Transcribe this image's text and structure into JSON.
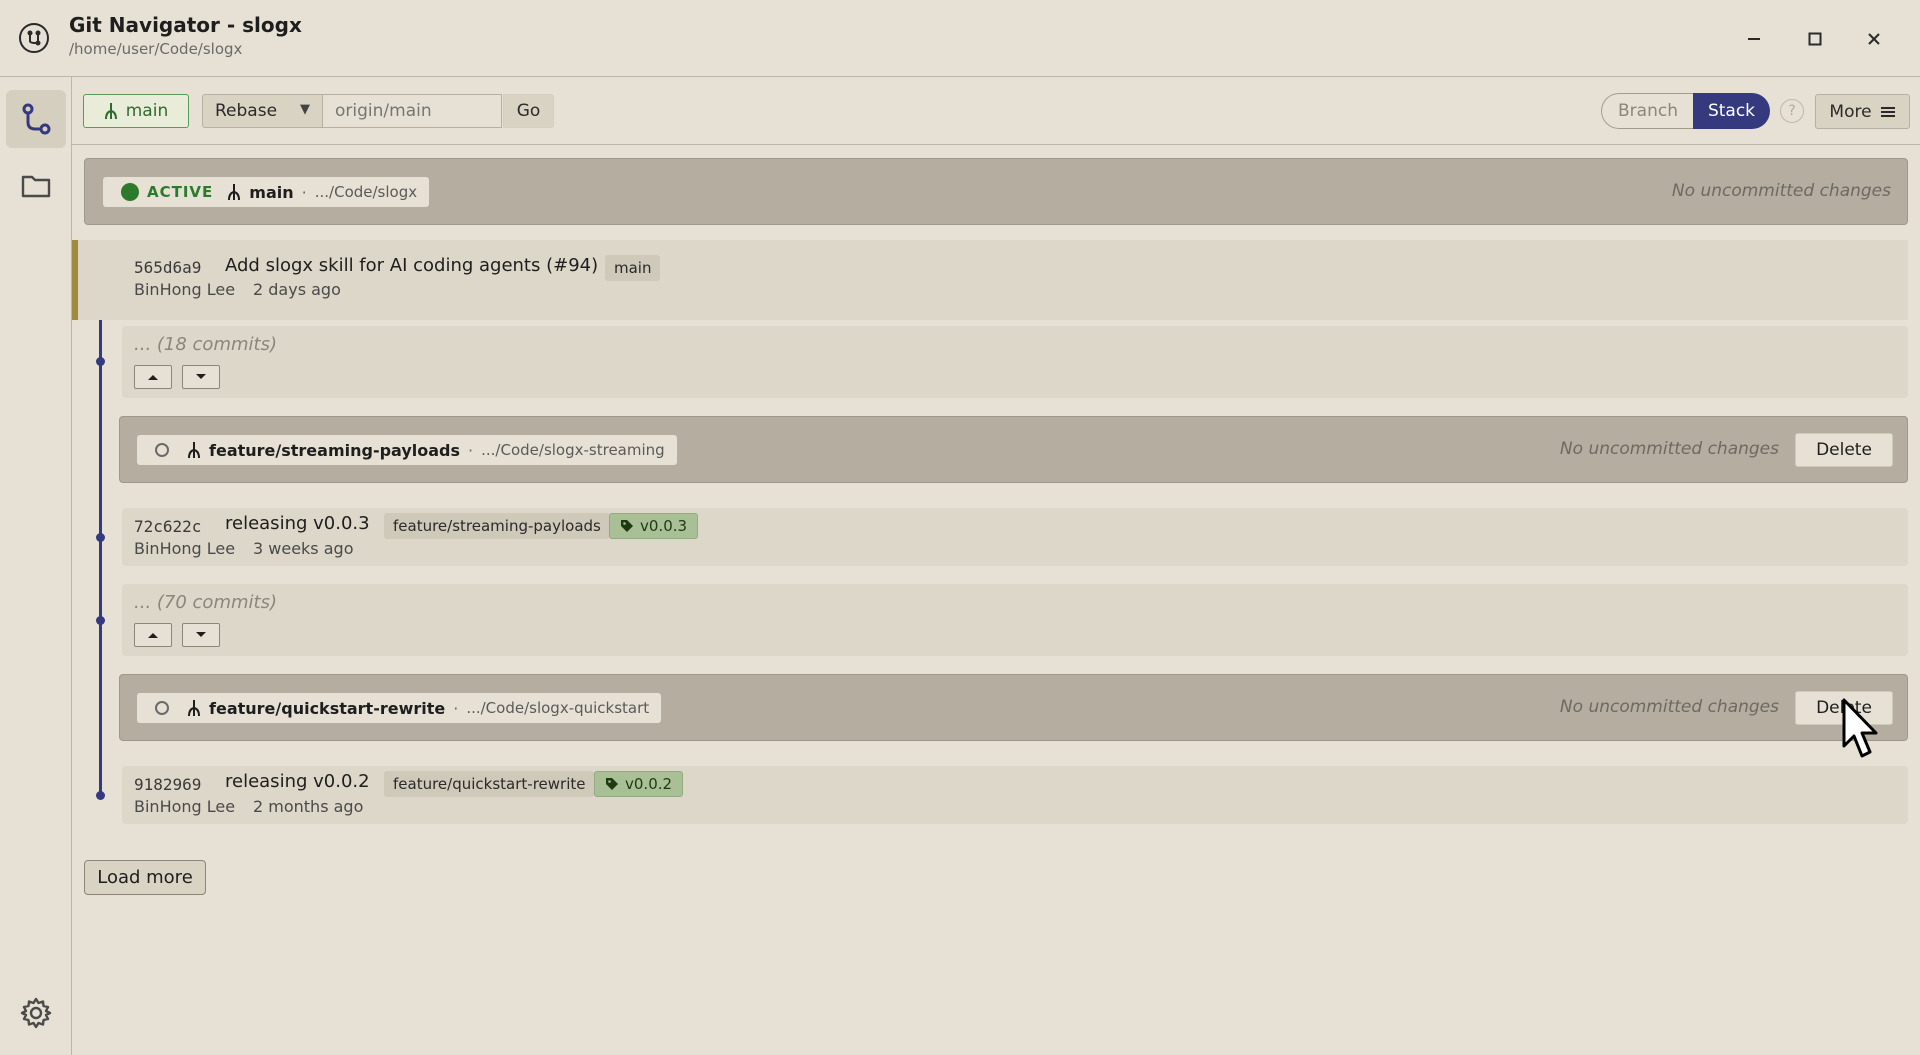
{
  "window": {
    "title": "Git Navigator - slogx",
    "path": "/home/user/Code/slogx",
    "logo_icon": "git-compass-icon",
    "controls": [
      "minimize-icon",
      "maximize-icon",
      "close-icon"
    ]
  },
  "sidebar": {
    "items": [
      {
        "name": "graph-view",
        "icon": "git-graph-icon",
        "active": true
      },
      {
        "name": "repositories",
        "icon": "folder-icon",
        "active": false
      }
    ],
    "settings_icon": "gear-icon"
  },
  "toolbar": {
    "current_branch": "main",
    "strategy": "Rebase",
    "upstream_placeholder": "origin/main",
    "go_label": "Go",
    "view_modes": [
      "Branch",
      "Stack"
    ],
    "active_view": "Stack",
    "help_label": "?",
    "more_label": "More"
  },
  "stack": {
    "active_worktree": {
      "status_label": "ACTIVE",
      "branch": "main",
      "separator": "·",
      "path": ".../Code/slogx",
      "changes": "No uncommitted changes"
    },
    "head_commit": {
      "hash": "565d6a9",
      "message": "Add slogx skill for AI coding agents (#94)",
      "ref": "main",
      "author": "BinHong Lee",
      "time": "2 days ago"
    },
    "collapsed_1": {
      "label": "... (18 commits)"
    },
    "worktree_1": {
      "branch": "feature/streaming-payloads",
      "separator": "·",
      "path": ".../Code/slogx-streaming",
      "changes": "No uncommitted changes",
      "delete_label": "Delete"
    },
    "commit_1": {
      "hash": "72c622c",
      "message": "releasing v0.0.3",
      "ref": "feature/streaming-payloads",
      "tag": "v0.0.3",
      "author": "BinHong Lee",
      "time": "3 weeks ago"
    },
    "collapsed_2": {
      "label": "... (70 commits)"
    },
    "worktree_2": {
      "branch": "feature/quickstart-rewrite",
      "separator": "·",
      "path": ".../Code/slogx-quickstart",
      "changes": "No uncommitted changes",
      "delete_label": "Delete"
    },
    "commit_2": {
      "hash": "9182969",
      "message": "releasing v0.0.2",
      "ref": "feature/quickstart-rewrite",
      "tag": "v0.0.2",
      "author": "BinHong Lee",
      "time": "2 months ago"
    },
    "load_more_label": "Load more"
  },
  "colors": {
    "background": "#e6e1d4",
    "accent": "#35397e",
    "active_green": "#2c7a2c",
    "head_marker": "#a08a3c",
    "tag_green": "#a9bf95"
  }
}
